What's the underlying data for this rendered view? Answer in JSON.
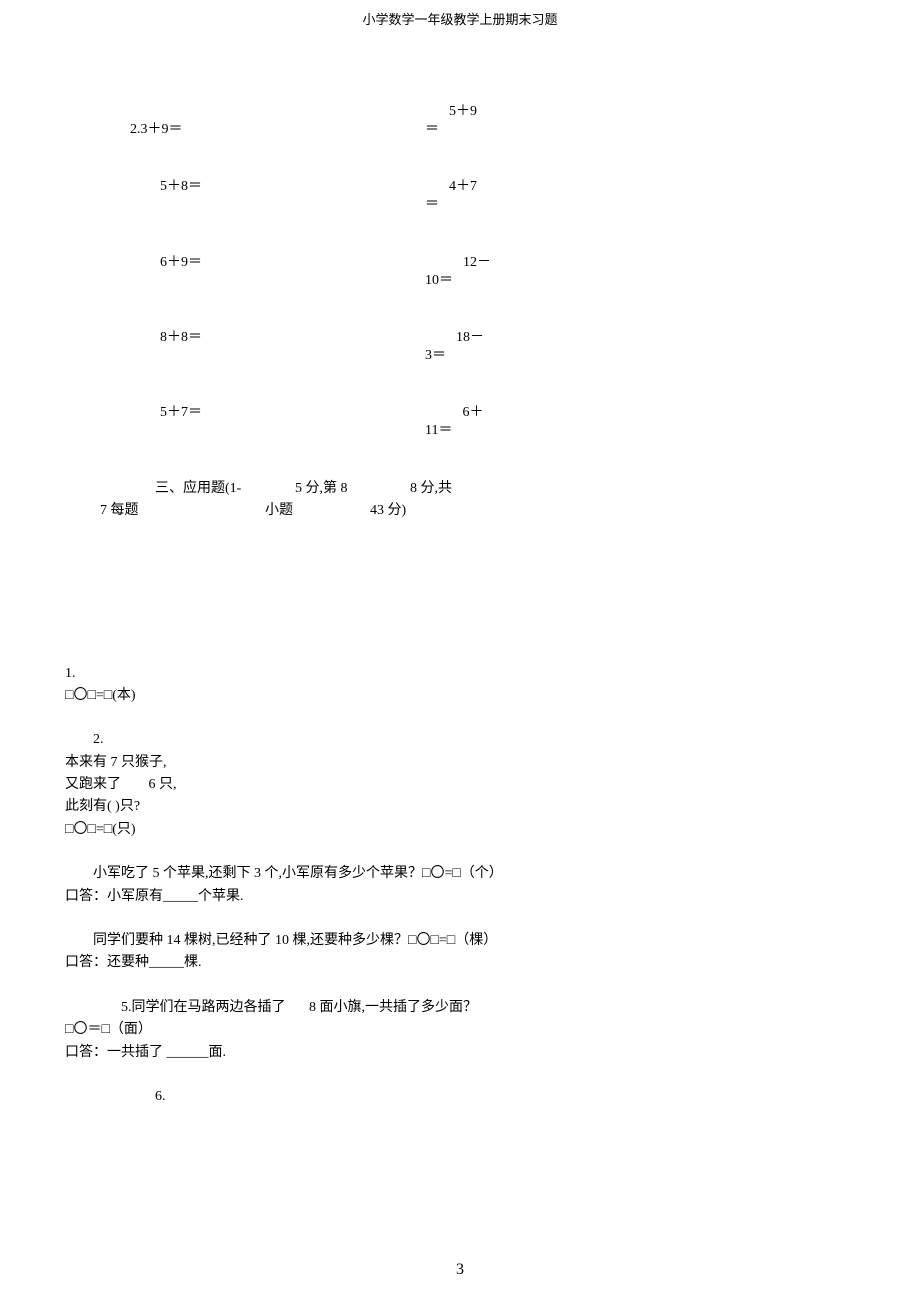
{
  "header": {
    "title": "小学数学一年级教学上册期末习题"
  },
  "math": {
    "r1_left_prefix": "2.",
    "r1_left": "3＋9＝",
    "r1_right_eq": "＝",
    "r1_right_expr": "5＋9",
    "r2_left": "5＋8＝",
    "r2_right_eq": "＝",
    "r2_right_expr": "4＋7",
    "r3_left": "6＋9＝",
    "r3_right_eq": "10＝",
    "r3_right_expr": "12－",
    "r4_left": "8＋8＝",
    "r4_right_eq": "3＝",
    "r4_right_expr": "18－",
    "r5_left": "5＋7＝",
    "r5_right_eq": "11＝",
    "r5_right_expr": "6＋"
  },
  "section_title": {
    "line1_p1": "三、应用题(1-",
    "line1_p2": "5 分,第 8",
    "line1_p3": "8 分,共",
    "line2_p1": "7 每题",
    "line2_p2": "小题",
    "line2_p3": "43 分)"
  },
  "problems": {
    "p1_num": "1.",
    "p1_line": "□〇□=□(本)",
    "p2_num": "2.",
    "p2_line1": "本来有 7 只猴子,",
    "p2_line2_a": "又跑来了",
    "p2_line2_b": "6 只,",
    "p2_line3": "此刻有( )只?",
    "p2_line4": "□〇□=□(只)",
    "p3_line1": "小军吃了 5 个苹果,还剩下 3 个,小军原有多少个苹果？□〇=□（个）",
    "p3_line2": "口答：小军原有_____个苹果.",
    "p4_line1": "同学们要种 14 棵树,已经种了 10 棵,还要种多少棵？□〇□=□（棵）",
    "p4_line2": "口答：还要种_____棵.",
    "p5_line1_a": "5.同学们在马路两边各插了",
    "p5_line1_b": "8 面小旗,一共插了多少面？",
    "p5_line2": "□〇＝□（面）",
    "p5_line3": "口答：一共插了  ______面.",
    "p6_num": "6."
  },
  "page_number": "3"
}
